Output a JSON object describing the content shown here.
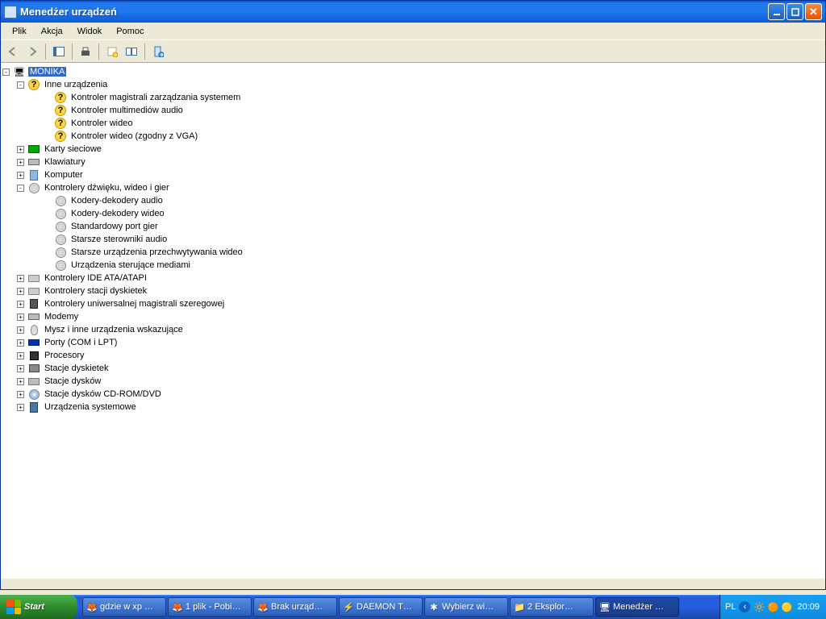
{
  "window": {
    "title": "Menedżer urządzeń"
  },
  "menu": {
    "file": "Plik",
    "action": "Akcja",
    "view": "Widok",
    "help": "Pomoc"
  },
  "tree": {
    "root": "MONIKA",
    "n_other": "Inne urządzenia",
    "n_other_c": [
      "Kontroler magistrali zarządzania systemem",
      "Kontroler multimediów audio",
      "Kontroler wideo",
      "Kontroler wideo (zgodny z VGA)"
    ],
    "n_net": "Karty sieciowe",
    "n_kbd": "Klawiatury",
    "n_comp": "Komputer",
    "n_snd": "Kontrolery dźwięku, wideo i gier",
    "n_snd_c": [
      "Kodery-dekodery audio",
      "Kodery-dekodery wideo",
      "Standardowy port gier",
      "Starsze sterowniki audio",
      "Starsze urządzenia przechwytywania wideo",
      "Urządzenia sterujące mediami"
    ],
    "n_ide": "Kontrolery IDE ATA/ATAPI",
    "n_fdc": "Kontrolery stacji dyskietek",
    "n_usb": "Kontrolery uniwersalnej magistrali szeregowej",
    "n_modem": "Modemy",
    "n_mouse": "Mysz i inne urządzenia wskazujące",
    "n_ports": "Porty (COM i LPT)",
    "n_cpu": "Procesory",
    "n_fdd": "Stacje dyskietek",
    "n_hdd": "Stacje dysków",
    "n_cd": "Stacje dysków CD-ROM/DVD",
    "n_sys": "Urządzenia systemowe"
  },
  "taskbar": {
    "start": "Start",
    "items": [
      "gdzie w xp …",
      "1 plik - Pobi…",
      "Brak urząd…",
      "DAEMON T…",
      "Wybierz wi…",
      "2 Eksplor…",
      "Menedżer …"
    ],
    "lang": "PL",
    "clock": "20:09"
  }
}
